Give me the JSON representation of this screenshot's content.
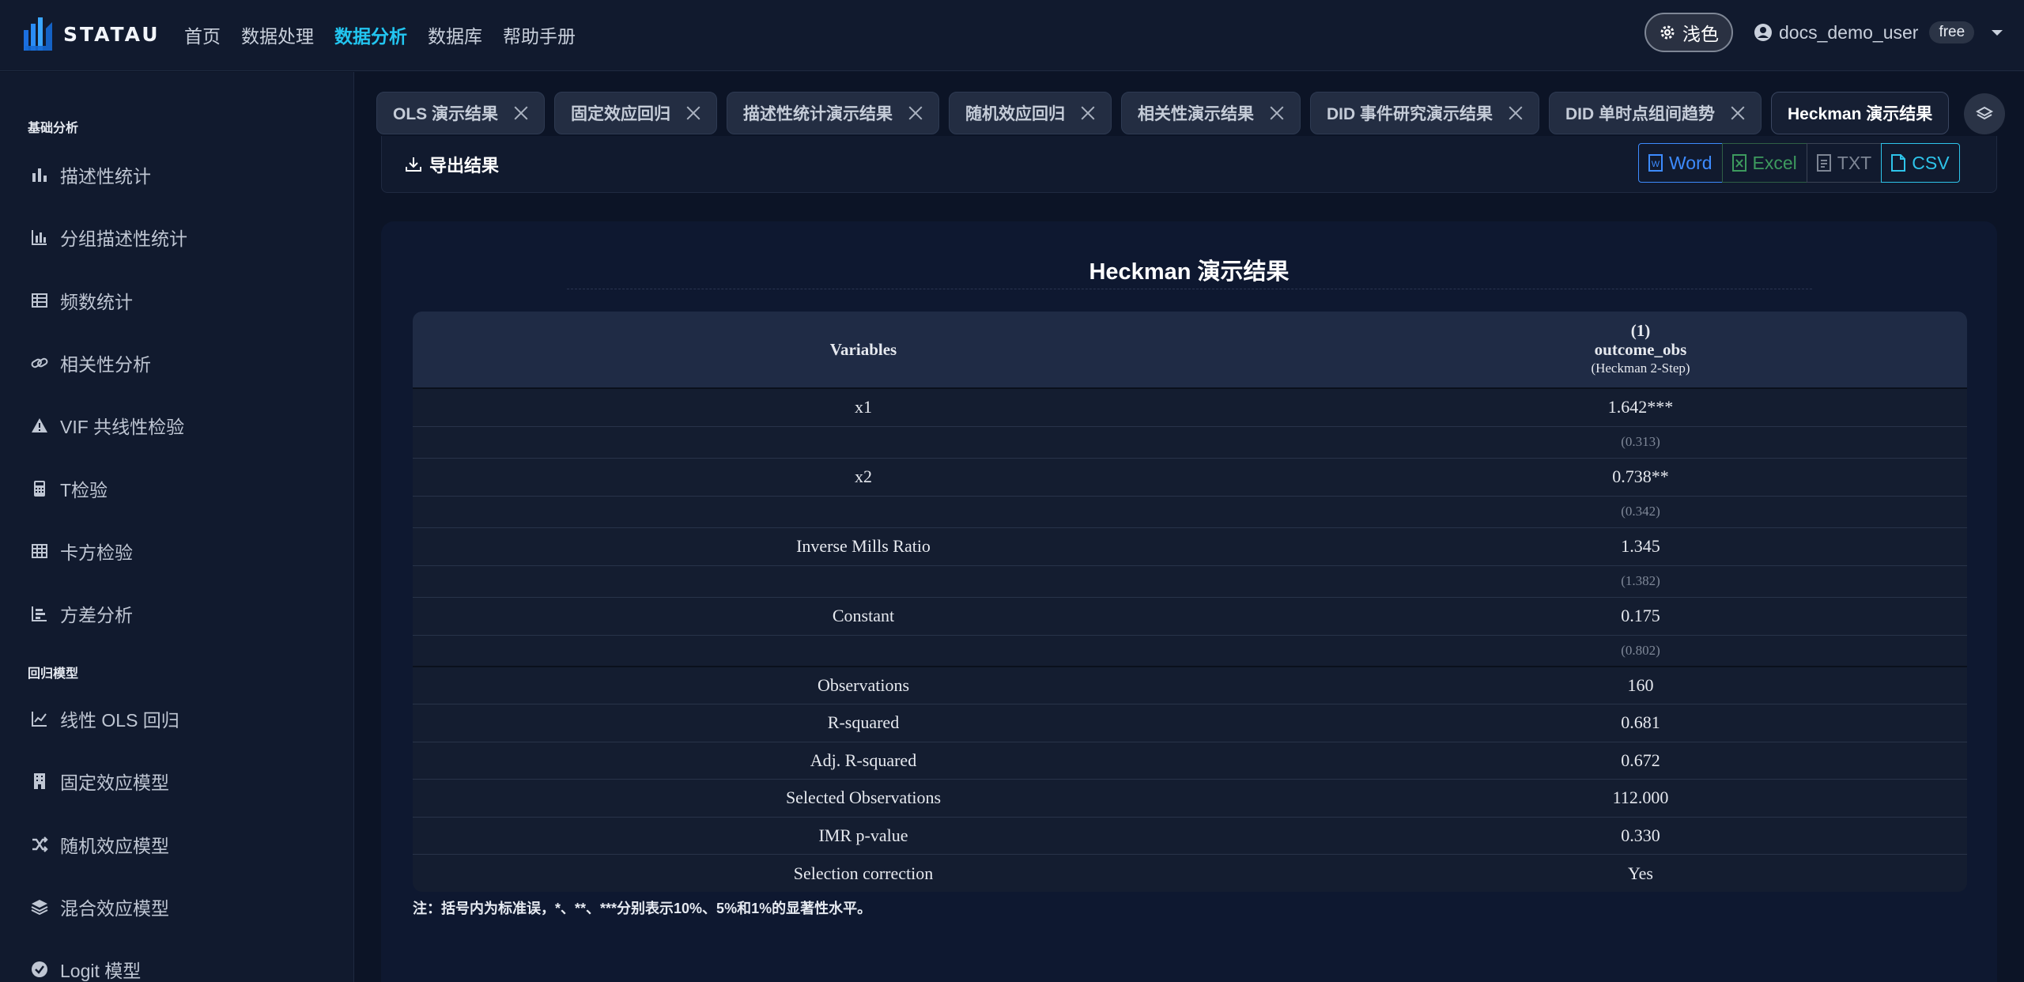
{
  "app": {
    "logo_text": "STATAU",
    "nav": [
      "首页",
      "数据处理",
      "数据分析",
      "数据库",
      "帮助手册"
    ],
    "active_nav": "数据分析",
    "theme_label": "浅色",
    "username": "docs_demo_user",
    "plan_badge": "free"
  },
  "sidebar": {
    "sections": [
      {
        "title": "基础分析",
        "items": [
          {
            "label": "描述性统计",
            "icon": "bar-chart-icon"
          },
          {
            "label": "分组描述性统计",
            "icon": "grouped-chart-icon"
          },
          {
            "label": "频数统计",
            "icon": "table-list-icon"
          },
          {
            "label": "相关性分析",
            "icon": "link-icon"
          },
          {
            "label": "VIF 共线性检验",
            "icon": "warning-icon"
          },
          {
            "label": "T检验",
            "icon": "calculator-icon"
          },
          {
            "label": "卡方检验",
            "icon": "grid-icon"
          },
          {
            "label": "方差分析",
            "icon": "bar-align-icon"
          }
        ]
      },
      {
        "title": "回归模型",
        "items": [
          {
            "label": "线性 OLS 回归",
            "icon": "line-chart-icon"
          },
          {
            "label": "固定效应模型",
            "icon": "building-icon"
          },
          {
            "label": "随机效应模型",
            "icon": "shuffle-icon"
          },
          {
            "label": "混合效应模型",
            "icon": "layers-icon"
          },
          {
            "label": "Logit 模型",
            "icon": "check-circle-icon"
          }
        ]
      }
    ]
  },
  "tabs": [
    {
      "label": "OLS 演示结果"
    },
    {
      "label": "固定效应回归"
    },
    {
      "label": "描述性统计演示结果"
    },
    {
      "label": "随机效应回归"
    },
    {
      "label": "相关性演示结果"
    },
    {
      "label": "DID 事件研究演示结果"
    },
    {
      "label": "DID 单时点组间趋势"
    },
    {
      "label": "Heckman 演示结果"
    }
  ],
  "active_tab": "Heckman 演示结果",
  "export": {
    "title": "导出结果",
    "buttons": [
      "Word",
      "Excel",
      "TXT",
      "CSV"
    ]
  },
  "result": {
    "title": "Heckman 演示结果",
    "header": {
      "variables_label": "Variables",
      "col_num": "(1)",
      "col_dep": "outcome_obs",
      "col_method": "(Heckman 2-Step)"
    },
    "coefficients": [
      {
        "name": "x1",
        "coef": "1.642***",
        "se": "(0.313)"
      },
      {
        "name": "x2",
        "coef": "0.738**",
        "se": "(0.342)"
      },
      {
        "name": "Inverse Mills Ratio",
        "coef": "1.345",
        "se": "(1.382)"
      },
      {
        "name": "Constant",
        "coef": "0.175",
        "se": "(0.802)"
      }
    ],
    "stats": [
      {
        "name": "Observations",
        "value": "160"
      },
      {
        "name": "R-squared",
        "value": "0.681"
      },
      {
        "name": "Adj. R-squared",
        "value": "0.672"
      },
      {
        "name": "Selected Observations",
        "value": "112.000"
      },
      {
        "name": "IMR p-value",
        "value": "0.330"
      },
      {
        "name": "Selection correction",
        "value": "Yes"
      }
    ],
    "note": "注：括号内为标准误，*、**、***分别表示10%、5%和1%的显著性水平。"
  }
}
